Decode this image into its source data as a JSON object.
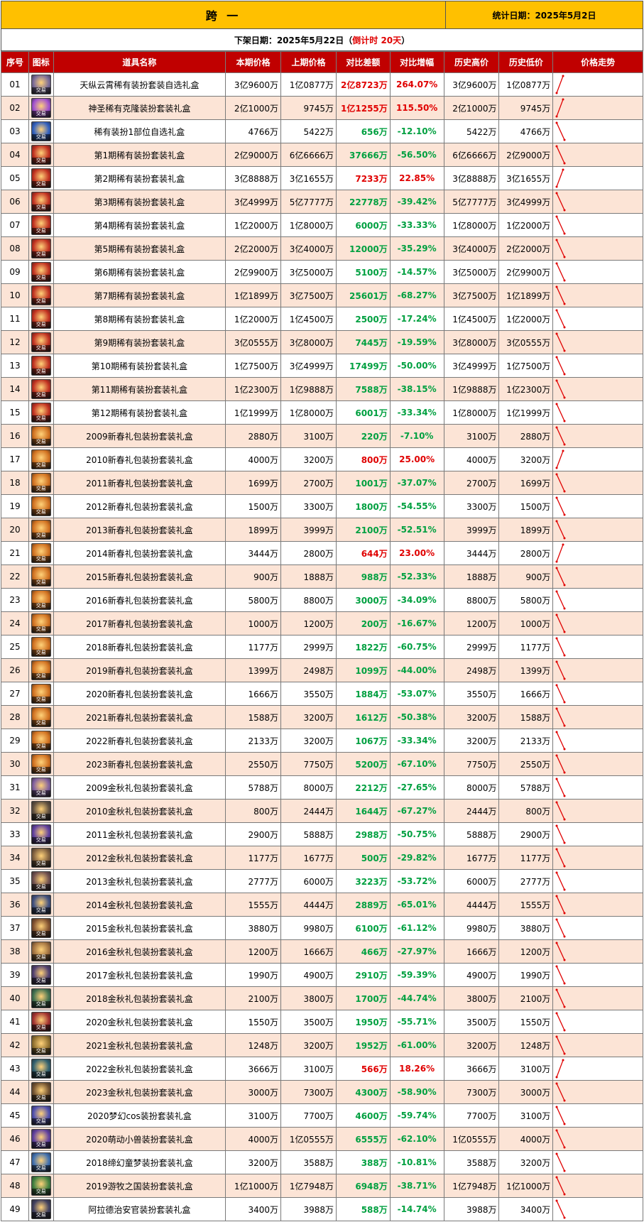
{
  "header": {
    "server": "跨 一",
    "stat_date": "统计日期：2025年5月2日",
    "delist_prefix": "下架日期：2025年5月22日（",
    "delist_countdown": "倒计时 20天",
    "delist_suffix": "）"
  },
  "columns": [
    "序号",
    "图标",
    "道具名称",
    "本期价格",
    "上期价格",
    "对比差额",
    "对比增幅",
    "历史高价",
    "历史低价",
    "价格走势"
  ],
  "icon_badge": "交易",
  "colors": {
    "up": "#E00000",
    "down": "#00A040",
    "header_bg": "#C00000",
    "title_bg": "#FFC000",
    "row_alt": "#FCE4D6"
  },
  "rows": [
    {
      "no": "01",
      "name": "天纵云霄稀有装扮套装自选礼盒",
      "cur": "3亿9600万",
      "prev": "1亿0877万",
      "diff": "2亿8723万",
      "pct": "264.07%",
      "high": "3亿9600万",
      "low": "1亿0877万",
      "dir": "up",
      "icon": "#7a6b9a"
    },
    {
      "no": "02",
      "name": "神圣稀有克隆装扮套装礼盒",
      "cur": "2亿1000万",
      "prev": "9745万",
      "diff": "1亿1255万",
      "pct": "115.50%",
      "high": "2亿1000万",
      "low": "9745万",
      "dir": "up",
      "icon": "#a050d0"
    },
    {
      "no": "03",
      "name": "稀有装扮1部位自选礼盒",
      "cur": "4766万",
      "prev": "5422万",
      "diff": "656万",
      "pct": "-12.10%",
      "high": "5422万",
      "low": "4766万",
      "dir": "down",
      "icon": "#3060c0"
    },
    {
      "no": "04",
      "name": "第1期稀有装扮套装礼盒",
      "cur": "2亿9000万",
      "prev": "6亿6666万",
      "diff": "37666万",
      "pct": "-56.50%",
      "high": "6亿6666万",
      "low": "2亿9000万",
      "dir": "down",
      "icon": "#c03020"
    },
    {
      "no": "05",
      "name": "第2期稀有装扮套装礼盒",
      "cur": "3亿8888万",
      "prev": "3亿1655万",
      "diff": "7233万",
      "pct": "22.85%",
      "high": "3亿8888万",
      "low": "3亿1655万",
      "dir": "up",
      "icon": "#c03020"
    },
    {
      "no": "06",
      "name": "第3期稀有装扮套装礼盒",
      "cur": "3亿4999万",
      "prev": "5亿7777万",
      "diff": "22778万",
      "pct": "-39.42%",
      "high": "5亿7777万",
      "low": "3亿4999万",
      "dir": "down",
      "icon": "#c03020"
    },
    {
      "no": "07",
      "name": "第4期稀有装扮套装礼盒",
      "cur": "1亿2000万",
      "prev": "1亿8000万",
      "diff": "6000万",
      "pct": "-33.33%",
      "high": "1亿8000万",
      "low": "1亿2000万",
      "dir": "down",
      "icon": "#c03020"
    },
    {
      "no": "08",
      "name": "第5期稀有装扮套装礼盒",
      "cur": "2亿2000万",
      "prev": "3亿4000万",
      "diff": "12000万",
      "pct": "-35.29%",
      "high": "3亿4000万",
      "low": "2亿2000万",
      "dir": "down",
      "icon": "#c03020"
    },
    {
      "no": "09",
      "name": "第6期稀有装扮套装礼盒",
      "cur": "2亿9900万",
      "prev": "3亿5000万",
      "diff": "5100万",
      "pct": "-14.57%",
      "high": "3亿5000万",
      "low": "2亿9900万",
      "dir": "down",
      "icon": "#c03020"
    },
    {
      "no": "10",
      "name": "第7期稀有装扮套装礼盒",
      "cur": "1亿1899万",
      "prev": "3亿7500万",
      "diff": "25601万",
      "pct": "-68.27%",
      "high": "3亿7500万",
      "low": "1亿1899万",
      "dir": "down",
      "icon": "#c03020"
    },
    {
      "no": "11",
      "name": "第8期稀有装扮套装礼盒",
      "cur": "1亿2000万",
      "prev": "1亿4500万",
      "diff": "2500万",
      "pct": "-17.24%",
      "high": "1亿4500万",
      "low": "1亿2000万",
      "dir": "down",
      "icon": "#c03020"
    },
    {
      "no": "12",
      "name": "第9期稀有装扮套装礼盒",
      "cur": "3亿0555万",
      "prev": "3亿8000万",
      "diff": "7445万",
      "pct": "-19.59%",
      "high": "3亿8000万",
      "low": "3亿0555万",
      "dir": "down",
      "icon": "#c03020"
    },
    {
      "no": "13",
      "name": "第10期稀有装扮套装礼盒",
      "cur": "1亿7500万",
      "prev": "3亿4999万",
      "diff": "17499万",
      "pct": "-50.00%",
      "high": "3亿4999万",
      "low": "1亿7500万",
      "dir": "down",
      "icon": "#c03020"
    },
    {
      "no": "14",
      "name": "第11期稀有装扮套装礼盒",
      "cur": "1亿2300万",
      "prev": "1亿9888万",
      "diff": "7588万",
      "pct": "-38.15%",
      "high": "1亿9888万",
      "low": "1亿2300万",
      "dir": "down",
      "icon": "#c03020"
    },
    {
      "no": "15",
      "name": "第12期稀有装扮套装礼盒",
      "cur": "1亿1999万",
      "prev": "1亿8000万",
      "diff": "6001万",
      "pct": "-33.34%",
      "high": "1亿8000万",
      "low": "1亿1999万",
      "dir": "down",
      "icon": "#c03020"
    },
    {
      "no": "16",
      "name": "2009新春礼包装扮套装礼盒",
      "cur": "2880万",
      "prev": "3100万",
      "diff": "220万",
      "pct": "-7.10%",
      "high": "3100万",
      "low": "2880万",
      "dir": "down",
      "icon": "#d07020"
    },
    {
      "no": "17",
      "name": "2010新春礼包装扮套装礼盒",
      "cur": "4000万",
      "prev": "3200万",
      "diff": "800万",
      "pct": "25.00%",
      "high": "4000万",
      "low": "3200万",
      "dir": "up",
      "icon": "#d07020"
    },
    {
      "no": "18",
      "name": "2011新春礼包装扮套装礼盒",
      "cur": "1699万",
      "prev": "2700万",
      "diff": "1001万",
      "pct": "-37.07%",
      "high": "2700万",
      "low": "1699万",
      "dir": "down",
      "icon": "#d07020"
    },
    {
      "no": "19",
      "name": "2012新春礼包装扮套装礼盒",
      "cur": "1500万",
      "prev": "3300万",
      "diff": "1800万",
      "pct": "-54.55%",
      "high": "3300万",
      "low": "1500万",
      "dir": "down",
      "icon": "#d07020"
    },
    {
      "no": "20",
      "name": "2013新春礼包装扮套装礼盒",
      "cur": "1899万",
      "prev": "3999万",
      "diff": "2100万",
      "pct": "-52.51%",
      "high": "3999万",
      "low": "1899万",
      "dir": "down",
      "icon": "#d07020"
    },
    {
      "no": "21",
      "name": "2014新春礼包装扮套装礼盒",
      "cur": "3444万",
      "prev": "2800万",
      "diff": "644万",
      "pct": "23.00%",
      "high": "3444万",
      "low": "2800万",
      "dir": "up",
      "icon": "#d07020"
    },
    {
      "no": "22",
      "name": "2015新春礼包装扮套装礼盒",
      "cur": "900万",
      "prev": "1888万",
      "diff": "988万",
      "pct": "-52.33%",
      "high": "1888万",
      "low": "900万",
      "dir": "down",
      "icon": "#d07020"
    },
    {
      "no": "23",
      "name": "2016新春礼包装扮套装礼盒",
      "cur": "5800万",
      "prev": "8800万",
      "diff": "3000万",
      "pct": "-34.09%",
      "high": "8800万",
      "low": "5800万",
      "dir": "down",
      "icon": "#d07020"
    },
    {
      "no": "24",
      "name": "2017新春礼包装扮套装礼盒",
      "cur": "1000万",
      "prev": "1200万",
      "diff": "200万",
      "pct": "-16.67%",
      "high": "1200万",
      "low": "1000万",
      "dir": "down",
      "icon": "#d07020"
    },
    {
      "no": "25",
      "name": "2018新春礼包装扮套装礼盒",
      "cur": "1177万",
      "prev": "2999万",
      "diff": "1822万",
      "pct": "-60.75%",
      "high": "2999万",
      "low": "1177万",
      "dir": "down",
      "icon": "#d07020"
    },
    {
      "no": "26",
      "name": "2019新春礼包装扮套装礼盒",
      "cur": "1399万",
      "prev": "2498万",
      "diff": "1099万",
      "pct": "-44.00%",
      "high": "2498万",
      "low": "1399万",
      "dir": "down",
      "icon": "#d07020"
    },
    {
      "no": "27",
      "name": "2020新春礼包装扮套装礼盒",
      "cur": "1666万",
      "prev": "3550万",
      "diff": "1884万",
      "pct": "-53.07%",
      "high": "3550万",
      "low": "1666万",
      "dir": "down",
      "icon": "#d07020"
    },
    {
      "no": "28",
      "name": "2021新春礼包装扮套装礼盒",
      "cur": "1588万",
      "prev": "3200万",
      "diff": "1612万",
      "pct": "-50.38%",
      "high": "3200万",
      "low": "1588万",
      "dir": "down",
      "icon": "#d07020"
    },
    {
      "no": "29",
      "name": "2022新春礼包装扮套装礼盒",
      "cur": "2133万",
      "prev": "3200万",
      "diff": "1067万",
      "pct": "-33.34%",
      "high": "3200万",
      "low": "2133万",
      "dir": "down",
      "icon": "#d07020"
    },
    {
      "no": "30",
      "name": "2023新春礼包装扮套装礼盒",
      "cur": "2550万",
      "prev": "7750万",
      "diff": "5200万",
      "pct": "-67.10%",
      "high": "7750万",
      "low": "2550万",
      "dir": "down",
      "icon": "#d07020"
    },
    {
      "no": "31",
      "name": "2009金秋礼包装扮套装礼盒",
      "cur": "5788万",
      "prev": "8000万",
      "diff": "2212万",
      "pct": "-27.65%",
      "high": "8000万",
      "low": "5788万",
      "dir": "down",
      "icon": "#8060a0"
    },
    {
      "no": "32",
      "name": "2010金秋礼包装扮套装礼盒",
      "cur": "800万",
      "prev": "2444万",
      "diff": "1644万",
      "pct": "-67.27%",
      "high": "2444万",
      "low": "800万",
      "dir": "down",
      "icon": "#605040"
    },
    {
      "no": "33",
      "name": "2011金秋礼包装扮套装礼盒",
      "cur": "2900万",
      "prev": "5888万",
      "diff": "2988万",
      "pct": "-50.75%",
      "high": "5888万",
      "low": "2900万",
      "dir": "down",
      "icon": "#6040a0"
    },
    {
      "no": "34",
      "name": "2012金秋礼包装扮套装礼盒",
      "cur": "1177万",
      "prev": "1677万",
      "diff": "500万",
      "pct": "-29.82%",
      "high": "1677万",
      "low": "1177万",
      "dir": "down",
      "icon": "#806040"
    },
    {
      "no": "35",
      "name": "2013金秋礼包装扮套装礼盒",
      "cur": "2777万",
      "prev": "6000万",
      "diff": "3223万",
      "pct": "-53.72%",
      "high": "6000万",
      "low": "2777万",
      "dir": "down",
      "icon": "#705050"
    },
    {
      "no": "36",
      "name": "2014金秋礼包装扮套装礼盒",
      "cur": "1555万",
      "prev": "4444万",
      "diff": "2889万",
      "pct": "-65.01%",
      "high": "4444万",
      "low": "1555万",
      "dir": "down",
      "icon": "#405080"
    },
    {
      "no": "37",
      "name": "2015金秋礼包装扮套装礼盒",
      "cur": "3880万",
      "prev": "9980万",
      "diff": "6100万",
      "pct": "-61.12%",
      "high": "9980万",
      "low": "3880万",
      "dir": "down",
      "icon": "#805030"
    },
    {
      "no": "38",
      "name": "2016金秋礼包装扮套装礼盒",
      "cur": "1200万",
      "prev": "1666万",
      "diff": "466万",
      "pct": "-27.97%",
      "high": "1666万",
      "low": "1200万",
      "dir": "down",
      "icon": "#a07040"
    },
    {
      "no": "39",
      "name": "2017金秋礼包装扮套装礼盒",
      "cur": "1990万",
      "prev": "4900万",
      "diff": "2910万",
      "pct": "-59.39%",
      "high": "4900万",
      "low": "1990万",
      "dir": "down",
      "icon": "#504070"
    },
    {
      "no": "40",
      "name": "2018金秋礼包装扮套装礼盒",
      "cur": "2100万",
      "prev": "3800万",
      "diff": "1700万",
      "pct": "-44.74%",
      "high": "3800万",
      "low": "2100万",
      "dir": "down",
      "icon": "#407050"
    },
    {
      "no": "41",
      "name": "2020金秋礼包装扮套装礼盒",
      "cur": "1550万",
      "prev": "3500万",
      "diff": "1950万",
      "pct": "-55.71%",
      "high": "3500万",
      "low": "1550万",
      "dir": "down",
      "icon": "#a03030"
    },
    {
      "no": "42",
      "name": "2021金秋礼包装扮套装礼盒",
      "cur": "1248万",
      "prev": "3200万",
      "diff": "1952万",
      "pct": "-61.00%",
      "high": "3200万",
      "low": "1248万",
      "dir": "down",
      "icon": "#907030"
    },
    {
      "no": "43",
      "name": "2022金秋礼包装扮套装礼盒",
      "cur": "3666万",
      "prev": "3100万",
      "diff": "566万",
      "pct": "18.26%",
      "high": "3666万",
      "low": "3100万",
      "dir": "up",
      "icon": "#306070"
    },
    {
      "no": "44",
      "name": "2023金秋礼包装扮套装礼盒",
      "cur": "3000万",
      "prev": "7300万",
      "diff": "4300万",
      "pct": "-58.90%",
      "high": "7300万",
      "low": "3000万",
      "dir": "down",
      "icon": "#705030"
    },
    {
      "no": "45",
      "name": "2020梦幻cos装扮套装礼盒",
      "cur": "3100万",
      "prev": "7700万",
      "diff": "4600万",
      "pct": "-59.74%",
      "high": "7700万",
      "low": "3100万",
      "dir": "down",
      "icon": "#5050b0"
    },
    {
      "no": "46",
      "name": "2020萌动小兽装扮套装礼盒",
      "cur": "4000万",
      "prev": "1亿0555万",
      "diff": "6555万",
      "pct": "-62.10%",
      "high": "1亿0555万",
      "low": "4000万",
      "dir": "down",
      "icon": "#6040a0"
    },
    {
      "no": "47",
      "name": "2018缔幻童梦装扮套装礼盒",
      "cur": "3200万",
      "prev": "3588万",
      "diff": "388万",
      "pct": "-10.81%",
      "high": "3588万",
      "low": "3200万",
      "dir": "down",
      "icon": "#4070b0"
    },
    {
      "no": "48",
      "name": "2019游牧之国装扮套装礼盒",
      "cur": "1亿1000万",
      "prev": "1亿7948万",
      "diff": "6948万",
      "pct": "-38.71%",
      "high": "1亿7948万",
      "low": "1亿1000万",
      "dir": "down",
      "icon": "#408040"
    },
    {
      "no": "49",
      "name": "阿拉德治安官装扮套装礼盒",
      "cur": "3400万",
      "prev": "3988万",
      "diff": "588万",
      "pct": "-14.74%",
      "high": "3988万",
      "low": "3400万",
      "dir": "down",
      "icon": "#404060"
    }
  ]
}
